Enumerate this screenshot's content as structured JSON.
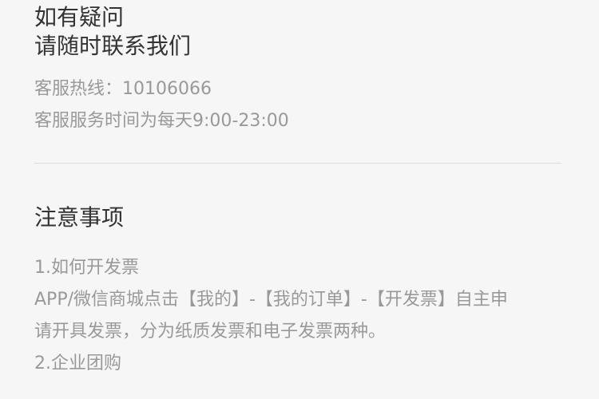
{
  "contact": {
    "title_line1": "如有疑问",
    "title_line2": "请随时联系我们",
    "hotline": "客服热线：10106066",
    "hours": "客服服务时间为每天9:00-23:00"
  },
  "notes": {
    "title": "注意事项",
    "items": [
      "1.如何开发票",
      "APP/微信商城点击【我的】-【我的订单】-【开发票】自主申",
      "请开具发票，分为纸质发票和电子发票两种。",
      "2.企业团购"
    ]
  }
}
